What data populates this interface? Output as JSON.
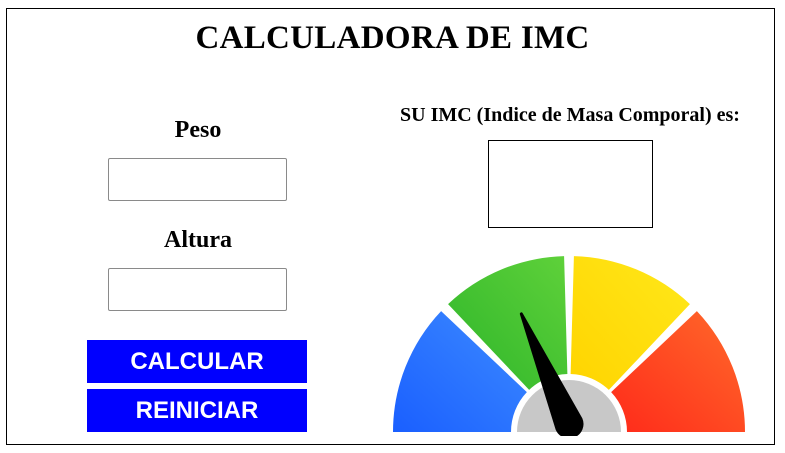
{
  "app": {
    "title": "CALCULADORA DE IMC"
  },
  "form": {
    "peso_label": "Peso",
    "peso_value": "",
    "altura_label": "Altura",
    "altura_value": ""
  },
  "buttons": {
    "calcular_label": "CALCULAR",
    "reiniciar_label": "REINICIAR"
  },
  "result": {
    "label": "SU IMC (Indice de Masa Comporal) es:",
    "value": ""
  },
  "gauge": {
    "segments": [
      {
        "color_start": "#1a5fff",
        "color_end": "#3d8bff",
        "name": "blue"
      },
      {
        "color_start": "#2db52a",
        "color_end": "#5fd13a",
        "name": "green"
      },
      {
        "color_start": "#ffd400",
        "color_end": "#ffe81a",
        "name": "yellow"
      },
      {
        "color_start": "#ff2a1a",
        "color_end": "#ff6a2a",
        "name": "red"
      }
    ],
    "needle_color": "#000000",
    "hub_color": "#c8c8c8",
    "needle_level": 0.37
  },
  "colors": {
    "button_bg": "#0000ff",
    "button_text": "#ffffff"
  }
}
